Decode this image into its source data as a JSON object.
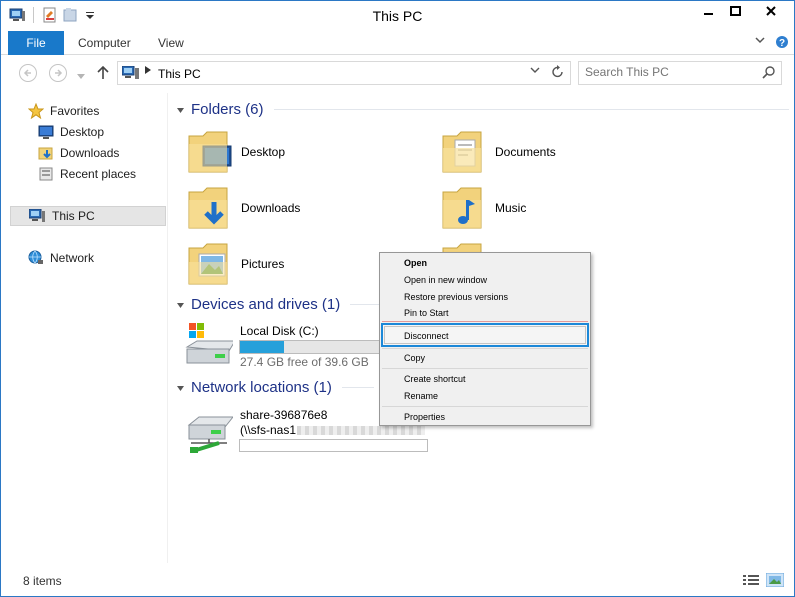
{
  "window": {
    "title": "This PC",
    "buttons": {
      "minimize": "—",
      "maximize": "▢",
      "close": "✕"
    }
  },
  "ribbon": {
    "tabs": [
      {
        "label": "File"
      },
      {
        "label": "Computer"
      },
      {
        "label": "View"
      }
    ]
  },
  "address": {
    "path": "This PC",
    "search_placeholder": "Search This PC"
  },
  "navpane": {
    "favorites": "Favorites",
    "desktop": "Desktop",
    "downloads": "Downloads",
    "recent": "Recent places",
    "thispc": "This PC",
    "network": "Network"
  },
  "sections": {
    "folders": "Folders (6)",
    "devices": "Devices and drives (1)",
    "network": "Network locations (1)"
  },
  "folders": [
    {
      "label": "Desktop"
    },
    {
      "label": "Documents"
    },
    {
      "label": "Downloads"
    },
    {
      "label": "Music"
    },
    {
      "label": "Pictures"
    }
  ],
  "local_disk": {
    "name": "Local Disk (C:)",
    "free": "27.4 GB free of 39.6 GB",
    "used_fraction": 0.31
  },
  "share": {
    "name": "share-396876e8",
    "path": "(\\\\sfs-nas1"
  },
  "context_menu": {
    "open": "Open",
    "open_new": "Open in new window",
    "restore": "Restore previous versions",
    "pin": "Pin to Start",
    "disconnect": "Disconnect",
    "copy": "Copy",
    "shortcut": "Create shortcut",
    "rename": "Rename",
    "properties": "Properties"
  },
  "status": {
    "items": "8 items"
  },
  "colors": {
    "accent": "#1979ca",
    "highlight": "#1c88d8",
    "section_text": "#1e3287",
    "bar_fill": "#26a0da"
  }
}
